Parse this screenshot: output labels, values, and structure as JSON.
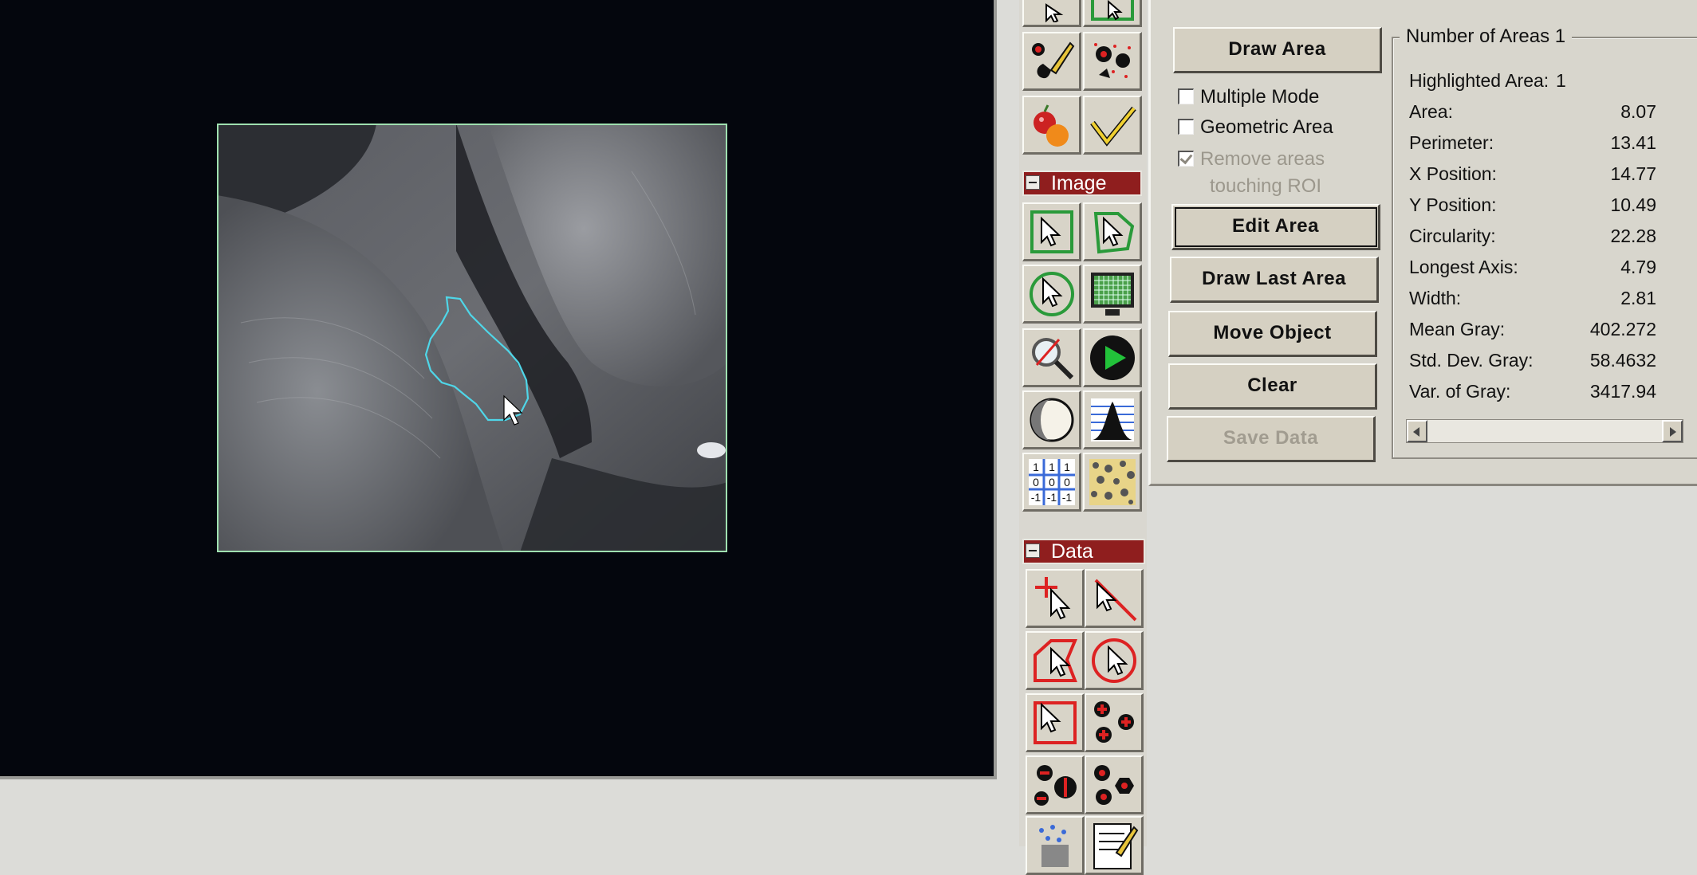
{
  "image_panel": {
    "palette_title": "Image"
  },
  "data_panel": {
    "palette_title": "Data"
  },
  "controls": {
    "draw_area": "Draw Area",
    "multiple_mode": "Multiple Mode",
    "geometric_area": "Geometric Area",
    "remove_areas_line1": "Remove areas",
    "remove_areas_line2": "touching ROI",
    "edit_area": "Edit Area",
    "draw_last_area": "Draw Last Area",
    "move_object": "Move Object",
    "clear": "Clear",
    "save_data": "Save Data"
  },
  "results": {
    "group_title": "Number of Areas 1",
    "rows": [
      {
        "label": "Highlighted Area:",
        "value": "1"
      },
      {
        "label": "Area:",
        "value": "8.07"
      },
      {
        "label": "Perimeter:",
        "value": "13.41"
      },
      {
        "label": "X Position:",
        "value": "14.77"
      },
      {
        "label": "Y Position:",
        "value": "10.49"
      },
      {
        "label": "Circularity:",
        "value": "22.28"
      },
      {
        "label": "Longest Axis:",
        "value": "4.79"
      },
      {
        "label": "Width:",
        "value": "2.81"
      },
      {
        "label": "Mean Gray:",
        "value": "402.272"
      },
      {
        "label": "Std. Dev. Gray:",
        "value": "58.4632"
      },
      {
        "label": "Var. of Gray:",
        "value": "3417.94"
      }
    ]
  },
  "icons": {
    "image_tools": [
      "select-rect-icon",
      "select-polygon-icon",
      "select-ellipse-icon",
      "image-grid-icon",
      "magnifier-icon",
      "play-icon",
      "sphere-icon",
      "histogram-icon",
      "kernel-matrix-icon",
      "texture-icon"
    ],
    "data_tools": [
      "point-cursor-icon",
      "line-cursor-icon",
      "polygon-cursor-icon",
      "circle-cursor-icon",
      "rect-cursor-icon",
      "dots-plus-icon",
      "dots-minus-icon",
      "dots-hex-icon",
      "spray-icon",
      "notepad-icon"
    ]
  },
  "colors": {
    "palette_header": "#8f1e1e",
    "roi_outline": "#4fd6e8",
    "image_border": "#9fe0b0"
  }
}
